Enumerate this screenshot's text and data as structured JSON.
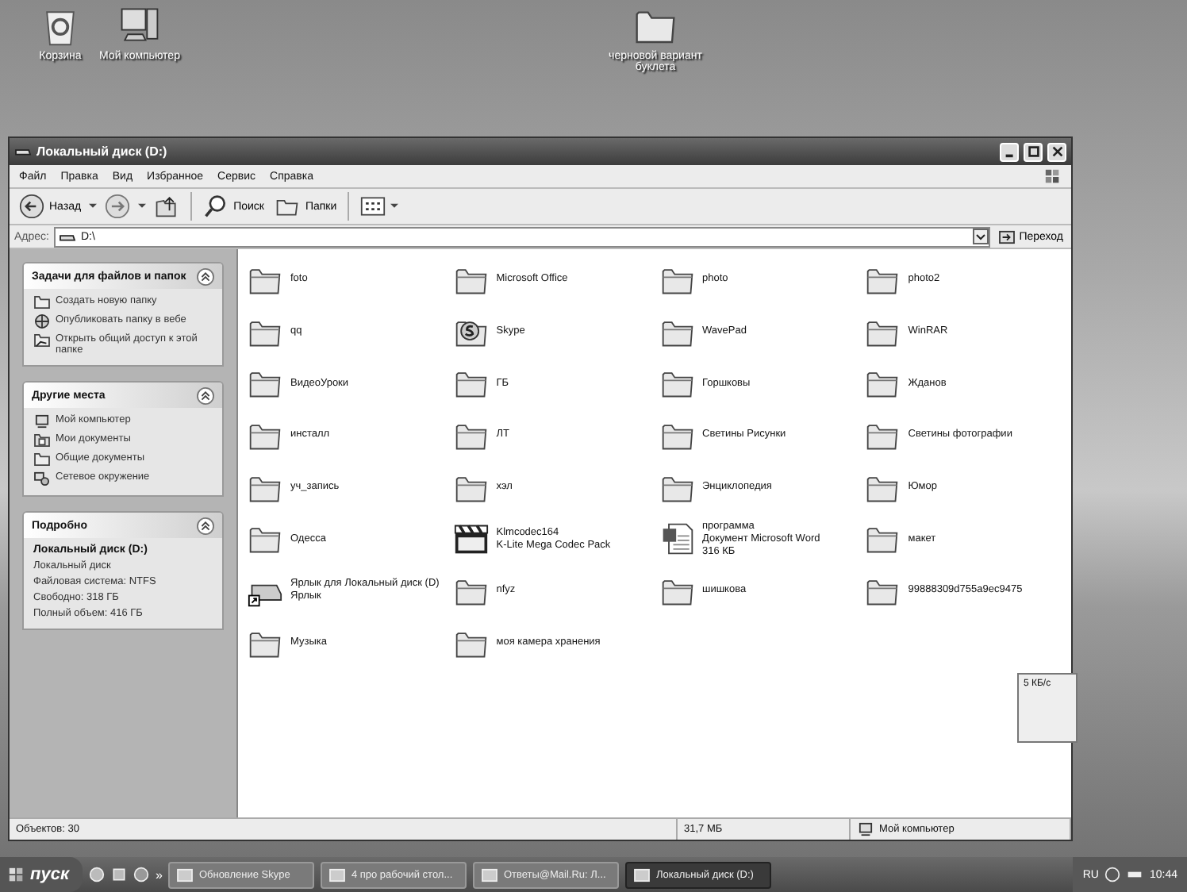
{
  "desktop_icons": [
    {
      "kind": "recycle",
      "label": "Корзина"
    },
    {
      "kind": "computer",
      "label": "Мой компьютер"
    },
    {
      "kind": "folder",
      "label": "черновой вариант буклета"
    }
  ],
  "window": {
    "title": "Локальный диск (D:)"
  },
  "menu": [
    "Файл",
    "Правка",
    "Вид",
    "Избранное",
    "Сервис",
    "Справка"
  ],
  "toolbar": {
    "back": "Назад",
    "search": "Поиск",
    "folders": "Папки"
  },
  "address": {
    "label": "Адрес:",
    "value": "D:\\",
    "go": "Переход"
  },
  "sidebar": [
    {
      "title": "Задачи для файлов и папок",
      "items": [
        {
          "label": "Создать новую папку"
        },
        {
          "label": "Опубликовать папку в вебе"
        },
        {
          "label": "Открыть общий доступ к этой папке"
        }
      ]
    },
    {
      "title": "Другие места",
      "items": [
        {
          "label": "Мой компьютер"
        },
        {
          "label": "Мои документы"
        },
        {
          "label": "Общие документы"
        },
        {
          "label": "Сетевое окружение"
        }
      ]
    },
    {
      "title": "Подробно",
      "details": {
        "name": "Локальный диск (D:)",
        "lines": [
          "Локальный диск",
          "Файловая система: NTFS",
          "Свободно: 318 ГБ",
          "Полный объем: 416 ГБ"
        ]
      }
    }
  ],
  "files": [
    {
      "kind": "folder",
      "lines": [
        "foto"
      ]
    },
    {
      "kind": "folder",
      "lines": [
        "Microsoft Office"
      ]
    },
    {
      "kind": "folder",
      "lines": [
        "photo"
      ]
    },
    {
      "kind": "folder",
      "lines": [
        "photo2"
      ]
    },
    {
      "kind": "folder",
      "lines": [
        "qq"
      ]
    },
    {
      "kind": "skype",
      "lines": [
        "Skype"
      ]
    },
    {
      "kind": "folder",
      "lines": [
        "WavePad"
      ]
    },
    {
      "kind": "folder",
      "lines": [
        "WinRAR"
      ]
    },
    {
      "kind": "folder",
      "lines": [
        "ВидеоУроки"
      ]
    },
    {
      "kind": "folder",
      "lines": [
        "ГБ"
      ]
    },
    {
      "kind": "folder",
      "lines": [
        "Горшковы"
      ]
    },
    {
      "kind": "folder",
      "lines": [
        "Жданов"
      ]
    },
    {
      "kind": "folder",
      "lines": [
        "инсталл"
      ]
    },
    {
      "kind": "folder",
      "lines": [
        "ЛТ"
      ]
    },
    {
      "kind": "folder",
      "lines": [
        "Светины Рисунки"
      ]
    },
    {
      "kind": "folder",
      "lines": [
        "Светины фотографии"
      ]
    },
    {
      "kind": "folder",
      "lines": [
        "уч_запись"
      ]
    },
    {
      "kind": "folder",
      "lines": [
        "хэл"
      ]
    },
    {
      "kind": "folder",
      "lines": [
        "Энциклопедия"
      ]
    },
    {
      "kind": "folder",
      "lines": [
        "Юмор"
      ]
    },
    {
      "kind": "folder",
      "lines": [
        "Одесса"
      ]
    },
    {
      "kind": "app",
      "lines": [
        "Klmcodec164",
        "K-Lite Mega Codec Pack"
      ]
    },
    {
      "kind": "doc",
      "lines": [
        "программа",
        "Документ Microsoft Word",
        "316 КБ"
      ]
    },
    {
      "kind": "folder",
      "lines": [
        "макет"
      ]
    },
    {
      "kind": "shortcut",
      "lines": [
        "Ярлык для Локальный диск (D)",
        "Ярлык"
      ]
    },
    {
      "kind": "folder",
      "lines": [
        "nfyz"
      ]
    },
    {
      "kind": "folder",
      "lines": [
        "шишкова"
      ]
    },
    {
      "kind": "folder",
      "lines": [
        "99888309d755a9ec9475"
      ]
    },
    {
      "kind": "folder",
      "lines": [
        "Музыка"
      ]
    },
    {
      "kind": "folder",
      "lines": [
        "моя камера хранения"
      ]
    }
  ],
  "status_bar": {
    "objects": "Объектов: 30",
    "size": "31,7 МБ",
    "zone": "Мой компьютер"
  },
  "widget": {
    "text": "5 КБ/с"
  },
  "taskbar": {
    "start": "пуск",
    "chevron": "»",
    "tasks": [
      {
        "label": "Обновление Skype",
        "selected": false
      },
      {
        "label": "4 про рабочий стол...",
        "selected": false
      },
      {
        "label": "Ответы@Mail.Ru: Л...",
        "selected": false
      },
      {
        "label": "Локальный диск (D:)",
        "selected": true
      }
    ],
    "lang": "RU",
    "clock": "10:44"
  }
}
